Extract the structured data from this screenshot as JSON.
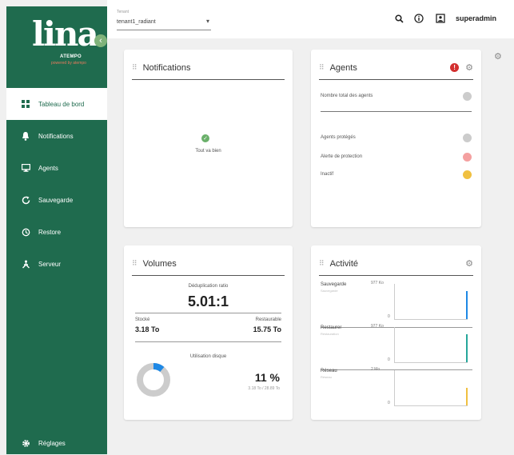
{
  "app": {
    "logo": "lina",
    "logo_brand": "ATEMPO",
    "logo_tagline": "powered by atempo"
  },
  "colors": {
    "sidebar": "#1f6b4e",
    "ok": "#6ab06a",
    "alert": "#d32f2f",
    "warning": "#f0c040",
    "gauge": "#1e88e5",
    "gauge_track": "#cccccc"
  },
  "sidebar": {
    "items": [
      {
        "label": "Tableau de bord",
        "icon": "dashboard-icon",
        "active": true
      },
      {
        "label": "Notifications",
        "icon": "bell-icon"
      },
      {
        "label": "Agents",
        "icon": "monitor-icon"
      },
      {
        "label": "Sauvegarde",
        "icon": "backup-icon"
      },
      {
        "label": "Restore",
        "icon": "restore-icon"
      },
      {
        "label": "Serveur",
        "icon": "server-icon"
      }
    ],
    "settings_label": "Réglages"
  },
  "topbar": {
    "tenant_label": "Tenant",
    "tenant_value": "tenant1_radiant",
    "username": "superadmin"
  },
  "notifications": {
    "title": "Notifications",
    "status": "Tout va bien"
  },
  "agents": {
    "title": "Agents",
    "alert_count": "!",
    "total_label": "Nombre total des agents",
    "rows": [
      {
        "label": "Agents protégés",
        "color": "#cccccc"
      },
      {
        "label": "Alerte de protection",
        "color": "#f4a0a0"
      },
      {
        "label": "Inactif",
        "color": "#f0c040"
      }
    ]
  },
  "volumes": {
    "title": "Volumes",
    "dedup_label": "Déduplication ratio",
    "dedup_value": "5.01:1",
    "stored_label": "Stocké",
    "stored_value": "3.18 To",
    "restorable_label": "Restaurable",
    "restorable_value": "15.75 To",
    "disk_label": "Utilisation disque",
    "disk_value": "11 %",
    "disk_fraction": 0.11,
    "disk_sub": "3.18 To / 28.89 To"
  },
  "activity": {
    "title": "Activité",
    "rows": [
      {
        "name": "Sauvegarde",
        "sub": "Sauvegarde",
        "max": "977 Ko",
        "zero": "0",
        "level": 0.8,
        "color": "#1e88e5"
      },
      {
        "name": "Restaurer",
        "sub": "Restauration",
        "max": "977 Ko",
        "zero": "0",
        "level": 0.8,
        "color": "#26a69a"
      },
      {
        "name": "Réseau",
        "sub": "Réseau",
        "max": "2 Mo",
        "zero": "0",
        "level": 0.5,
        "color": "#f0c040"
      }
    ]
  }
}
